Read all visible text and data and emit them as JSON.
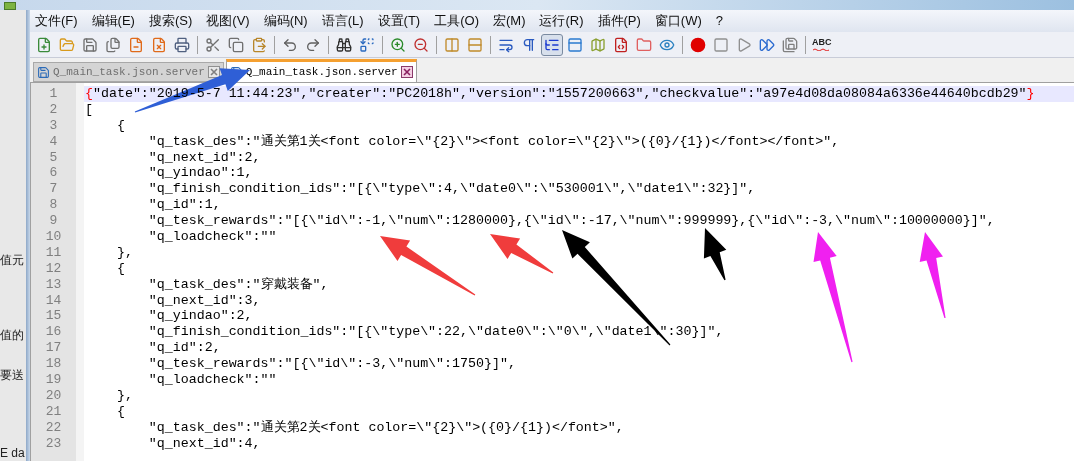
{
  "background_window": {
    "fragments": [
      "值元",
      "值的",
      "要送",
      "E da"
    ]
  },
  "menu": [
    "文件(F)",
    "编辑(E)",
    "搜索(S)",
    "视图(V)",
    "编码(N)",
    "语言(L)",
    "设置(T)",
    "工具(O)",
    "宏(M)",
    "运行(R)",
    "插件(P)",
    "窗口(W)",
    "?"
  ],
  "toolbar": [
    {
      "items": [
        {
          "kind": "new",
          "selected": false
        },
        {
          "kind": "open",
          "selected": false
        },
        {
          "kind": "save",
          "selected": false
        },
        {
          "kind": "save-all",
          "selected": false
        },
        {
          "kind": "close",
          "selected": false
        },
        {
          "kind": "close-all",
          "selected": false
        },
        {
          "kind": "print",
          "selected": false
        }
      ]
    },
    {
      "items": [
        {
          "kind": "cut",
          "selected": false
        },
        {
          "kind": "copy",
          "selected": false
        },
        {
          "kind": "paste",
          "selected": false
        }
      ]
    },
    {
      "items": [
        {
          "kind": "undo",
          "selected": false
        },
        {
          "kind": "redo",
          "selected": false
        }
      ]
    },
    {
      "items": [
        {
          "kind": "find",
          "selected": false
        },
        {
          "kind": "replace",
          "selected": false
        }
      ]
    },
    {
      "items": [
        {
          "kind": "zoom-in",
          "selected": false
        },
        {
          "kind": "zoom-out",
          "selected": false
        }
      ]
    },
    {
      "items": [
        {
          "kind": "sync-vertical",
          "selected": false
        },
        {
          "kind": "sync-horizontal",
          "selected": false
        }
      ]
    },
    {
      "items": [
        {
          "kind": "wrap",
          "selected": false
        },
        {
          "kind": "all-chars",
          "selected": false
        },
        {
          "kind": "indent-guide",
          "selected": true
        },
        {
          "kind": "panel",
          "selected": false
        },
        {
          "kind": "map",
          "selected": false
        },
        {
          "kind": "function",
          "selected": false
        },
        {
          "kind": "folder",
          "selected": false
        },
        {
          "kind": "monitor",
          "selected": false
        }
      ]
    },
    {
      "items": [
        {
          "kind": "record",
          "selected": false
        },
        {
          "kind": "stop",
          "selected": false
        },
        {
          "kind": "play",
          "selected": false
        },
        {
          "kind": "run-multiple",
          "selected": false
        },
        {
          "kind": "save-macro",
          "selected": false
        }
      ]
    },
    {
      "items": [
        {
          "kind": "spellcheck",
          "label": "ABC"
        }
      ]
    }
  ],
  "tabs": [
    {
      "label": "Q_main_task.json.server",
      "selected": false
    },
    {
      "label": "Q_main_task.json.server",
      "selected": true
    }
  ],
  "lines": [
    {
      "number": "1",
      "text": "{\"date\":\"2019-5-7 11:44:23\",\"creater\":\"PC2018h\",\"version\":\"1557200663\",\"checkvalue\":\"a97e4d08da08084a6336e44640bcdb29\"}",
      "current": true,
      "brace_match": true
    },
    {
      "number": "2",
      "text": "[",
      "current": false,
      "brace_match": false
    },
    {
      "number": "3",
      "text": "    {",
      "current": false,
      "brace_match": false
    },
    {
      "number": "4",
      "text": "        \"q_task_des\":\"通关第1关<font color=\\\"{2}\\\"><font color=\\\"{2}\\\">({0}/{1})</font></font>\",",
      "current": false,
      "brace_match": false
    },
    {
      "number": "5",
      "text": "        \"q_next_id\":2,",
      "current": false,
      "brace_match": false
    },
    {
      "number": "6",
      "text": "        \"q_yindao\":1,",
      "current": false,
      "brace_match": false
    },
    {
      "number": "7",
      "text": "        \"q_finish_condition_ids\":\"[{\\\"type\\\":4,\\\"date0\\\":\\\"530001\\\",\\\"date1\\\":32}]\",",
      "current": false,
      "brace_match": false
    },
    {
      "number": "8",
      "text": "        \"q_id\":1,",
      "current": false,
      "brace_match": false
    },
    {
      "number": "9",
      "text": "        \"q_tesk_rewards\":\"[{\\\"id\\\":-1,\\\"num\\\":1280000},{\\\"id\\\":-17,\\\"num\\\":999999},{\\\"id\\\":-3,\\\"num\\\":10000000}]\",",
      "current": false,
      "brace_match": false
    },
    {
      "number": "10",
      "text": "        \"q_loadcheck\":\"\"",
      "current": false,
      "brace_match": false
    },
    {
      "number": "11",
      "text": "    },",
      "current": false,
      "brace_match": false
    },
    {
      "number": "12",
      "text": "    {",
      "current": false,
      "brace_match": false
    },
    {
      "number": "13",
      "text": "        \"q_task_des\":\"穿戴装备\",",
      "current": false,
      "brace_match": false
    },
    {
      "number": "14",
      "text": "        \"q_next_id\":3,",
      "current": false,
      "brace_match": false
    },
    {
      "number": "15",
      "text": "        \"q_yindao\":2,",
      "current": false,
      "brace_match": false
    },
    {
      "number": "16",
      "text": "        \"q_finish_condition_ids\":\"[{\\\"type\\\":22,\\\"date0\\\":\\\"0\\\",\\\"date1\\\":30}]\",",
      "current": false,
      "brace_match": false
    },
    {
      "number": "17",
      "text": "        \"q_id\":2,",
      "current": false,
      "brace_match": false
    },
    {
      "number": "18",
      "text": "        \"q_tesk_rewards\":\"[{\\\"id\\\":-3,\\\"num\\\":1750}]\",",
      "current": false,
      "brace_match": false
    },
    {
      "number": "19",
      "text": "        \"q_loadcheck\":\"\"",
      "current": false,
      "brace_match": false
    },
    {
      "number": "20",
      "text": "    },",
      "current": false,
      "brace_match": false
    },
    {
      "number": "21",
      "text": "    {",
      "current": false,
      "brace_match": false
    },
    {
      "number": "22",
      "text": "        \"q_task_des\":\"通关第2关<font color=\\\"{2}\\\">({0}/{1})</font>\",",
      "current": false,
      "brace_match": false
    },
    {
      "number": "23",
      "text": "        \"q_next_id\":4,",
      "current": false,
      "brace_match": false
    }
  ],
  "annotations": [
    {
      "color": "#2f5fd6"
    },
    {
      "color": "#f03c3c"
    },
    {
      "color": "#f03c3c"
    },
    {
      "color": "#000000"
    },
    {
      "color": "#000000"
    },
    {
      "color": "#f020f0"
    },
    {
      "color": "#f020f0"
    }
  ]
}
